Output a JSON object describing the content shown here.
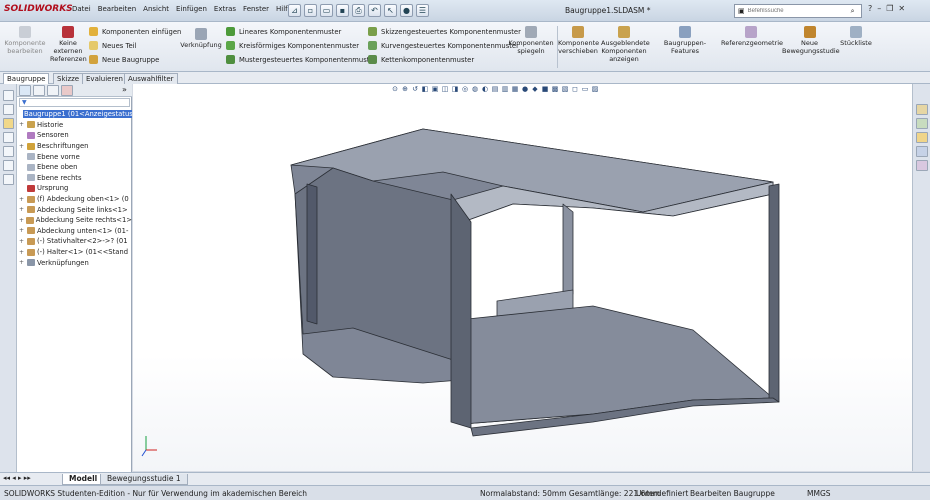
{
  "app": {
    "logo": "SOLIDWORKS",
    "document_title": "Baugruppe1.SLDASM *"
  },
  "menu": [
    "Datei",
    "Bearbeiten",
    "Ansicht",
    "Einfügen",
    "Extras",
    "Fenster",
    "Hilfe"
  ],
  "search": {
    "placeholder": "Befehlssuche"
  },
  "ribbon": {
    "komponente_bearbeiten": "Komponente bearbeiten",
    "keine_externen_referenzen": "Keine externen Referenzen",
    "komponenten_einfuegen": "Komponenten einfügen",
    "neues_teil": "Neues Teil",
    "neue_baugruppe": "Neue Baugruppe",
    "verknuepfung": "Verknüpfung",
    "lineares_komponentenmuster": "Lineares Komponentenmuster",
    "kreisfoermiges_komponentenmuster": "Kreisförmiges Komponentenmuster",
    "mustergesteuertes_komponentenmuster": "Mustergesteuertes Komponentenmuster",
    "skizzengesteuertes_komponentenmuster": "Skizzengesteuertes Komponentenmuster",
    "kurvengesteuertes_komponentenmuster": "Kurvengesteuertes Komponentenmuster",
    "kettenkomponentenmuster": "Kettenkomponentenmuster",
    "komponenten_spiegeln": "Komponenten spiegeln",
    "komponente_verschieben": "Komponente verschieben",
    "ausgeblendete_komponenten_anzeigen": "Ausgeblendete Komponenten anzeigen",
    "baugruppen_features": "Baugruppen-Features",
    "referenzgeometrie": "Referenzgeometrie",
    "neue_bewegungsstudie": "Neue Bewegungsstudie",
    "stueckliste": "Stückliste"
  },
  "command_tabs": [
    "Baugruppe",
    "Skizze",
    "Evaluieren",
    "Auswahlfilter"
  ],
  "tree": [
    {
      "label": "Baugruppe1  (01<Anzeigestatus>",
      "icon": "assembly-icon",
      "expander": "",
      "selected": true
    },
    {
      "label": "Historie",
      "icon": "history-icon",
      "expander": "+"
    },
    {
      "label": "Sensoren",
      "icon": "sensor-icon",
      "expander": ""
    },
    {
      "label": "Beschriftungen",
      "icon": "annotation-icon",
      "expander": "+"
    },
    {
      "label": "Ebene vorne",
      "icon": "plane-icon",
      "expander": ""
    },
    {
      "label": "Ebene oben",
      "icon": "plane-icon",
      "expander": ""
    },
    {
      "label": "Ebene rechts",
      "icon": "plane-icon",
      "expander": ""
    },
    {
      "label": "Ursprung",
      "icon": "origin-icon",
      "expander": ""
    },
    {
      "label": "(f) Abdeckung oben<1> (0",
      "icon": "part-icon",
      "expander": "+"
    },
    {
      "label": "Abdeckung Seite links<1>",
      "icon": "part-icon",
      "expander": "+"
    },
    {
      "label": "Abdeckung Seite rechts<1>",
      "icon": "part-icon",
      "expander": "+"
    },
    {
      "label": "Abdeckung unten<1> (01-",
      "icon": "part-icon",
      "expander": "+"
    },
    {
      "label": "(-) Stativhalter<2>->? (01",
      "icon": "part-icon",
      "expander": "+"
    },
    {
      "label": "(-) Halter<1> (01<<Stand",
      "icon": "part-icon",
      "expander": "+"
    },
    {
      "label": "Verknüpfungen",
      "icon": "mates-icon",
      "expander": "+"
    }
  ],
  "bottom_tabs": [
    "Modell",
    "Bewegungsstudie 1"
  ],
  "status": {
    "edition": "SOLIDWORKS Studenten-Edition - Nur für Verwendung im akademischen Bereich",
    "measure": "Normalabstand: 50mm Gesamtlänge: 221.6mm",
    "definition": "Unterdefiniert",
    "mode": "Bearbeiten Baugruppe",
    "units": "MMGS"
  },
  "colors": {
    "accent": "#3b6fcf",
    "model_face": "#8d94a3",
    "model_edge": "#2b2f36",
    "brand": "#b10d1c"
  }
}
